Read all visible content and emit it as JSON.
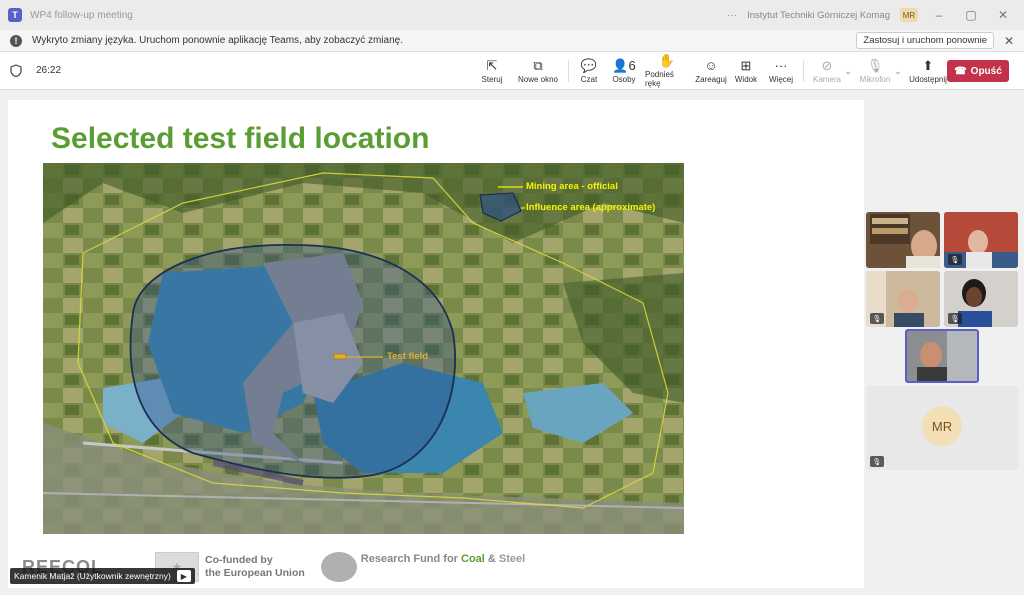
{
  "window": {
    "title": "WP4 follow-up meeting",
    "org": "Instytut Techniki Górniczej Komag",
    "user_initials": "MR",
    "more_label": "···",
    "minimize": "–",
    "maximize": "▢",
    "close": "✕",
    "app_icon": "T"
  },
  "notification": {
    "icon": "!",
    "text": "Wykryto zmiany języka. Uruchom ponownie aplikację Teams, aby zobaczyć zmianę.",
    "button_label": "Zastosuj i uruchom ponownie",
    "close": "✕"
  },
  "toolbar": {
    "timer": "26:22",
    "items": [
      {
        "label": "Steruj",
        "icon": "⇱"
      },
      {
        "label": "Nowe okno",
        "icon": "⧉"
      },
      {
        "label": "Czat",
        "icon": "💬"
      },
      {
        "label": "Osoby",
        "icon": "👤6"
      },
      {
        "label": "Podnieś rękę",
        "icon": "✋"
      },
      {
        "label": "Zareaguj",
        "icon": "☺"
      },
      {
        "label": "Widok",
        "icon": "⊞"
      },
      {
        "label": "Więcej",
        "icon": "···"
      },
      {
        "label": "Kamera",
        "icon": "⊘"
      },
      {
        "label": "Mikrofon",
        "icon": "🎙"
      },
      {
        "label": "Udostępnij",
        "icon": "⬆"
      }
    ],
    "caret": "⌄",
    "leave_label": "Opuść",
    "leave_icon": "☎"
  },
  "slide": {
    "title": "Selected test field location",
    "legend_official": "Mining area - official",
    "legend_influence": "Influence area (approximate)",
    "test_field_label": "Test field",
    "colors": {
      "title": "#5a9e32",
      "legend": "#f5f500",
      "test_field": "#e0b030"
    },
    "logos": {
      "reecol": "REECOL",
      "cofunded_line1": "Co-funded by",
      "cofunded_line2": "the European Union",
      "rfcs_prefix": "Research Fund for ",
      "rfcs_coal": "Coal",
      "rfcs_amp": " & ",
      "rfcs_steel": "Steel"
    }
  },
  "presenter": {
    "name": "Kamenik Matjaž (Użytkownik zewnętrzny)"
  },
  "participants": {
    "mr_initials": "MR",
    "mic_off_icon": "🎙"
  }
}
